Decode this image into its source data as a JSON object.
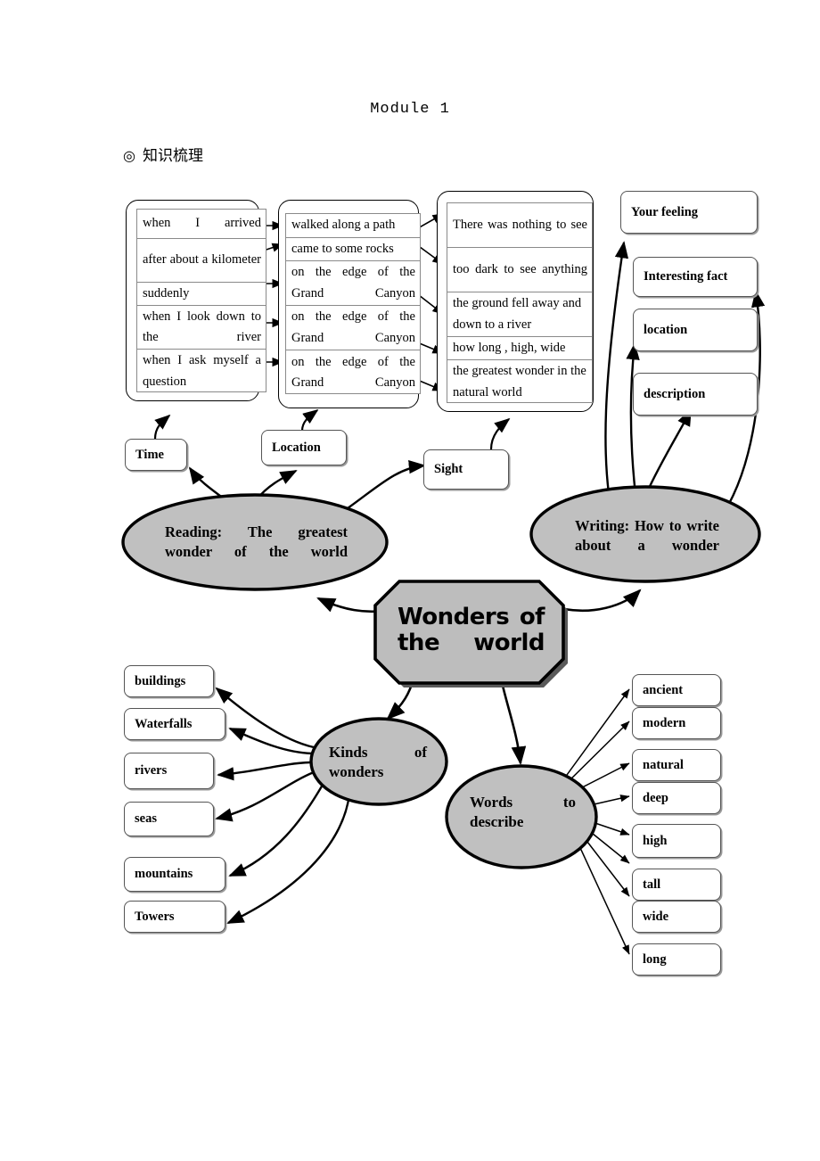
{
  "header": {
    "module_title": "Module 1",
    "section_bullet": "◎",
    "section_label": "知识梳理"
  },
  "columns": [
    {
      "name": "time-column",
      "rows": [
        "when I arrived",
        "after about a kilometer",
        "suddenly",
        "when I look down to the river",
        "when I ask myself a question"
      ]
    },
    {
      "name": "location-column",
      "rows": [
        "walked along a path",
        "came to some rocks",
        "on the edge of the Grand Canyon",
        "on the edge of the Grand Canyon",
        "on the edge of the Grand Canyon"
      ]
    },
    {
      "name": "sight-column",
      "rows": [
        "There was nothing to see",
        "too dark to see anything",
        "the ground fell away and down   to a river",
        "how long , high, wide",
        "the greatest wonder in the natural world"
      ]
    }
  ],
  "category_labels": {
    "time": "Time",
    "location": "Location",
    "sight": "Sight"
  },
  "writing_aspects": [
    "Your feeling",
    "Interesting fact",
    "location",
    "description"
  ],
  "nodes": {
    "center": "Wonders of the world",
    "reading": "Reading: The greatest wonder of the world",
    "writing": "Writing: How to write about a wonder",
    "kinds": "Kinds of wonders",
    "words": "Words to describe"
  },
  "kinds_items": [
    "buildings",
    "Waterfalls",
    "rivers",
    "seas",
    "mountains",
    "Towers"
  ],
  "describe_words": [
    "ancient",
    "modern",
    "natural",
    "deep",
    "high",
    "tall",
    "wide",
    "long"
  ],
  "colors": {
    "node_fill": "#c0c0c0",
    "center_fill": "#bdbdbd",
    "outline": "#000000",
    "box_border": "#555555",
    "shadow": "#9a9a9a",
    "page_bg": "#ffffff"
  }
}
